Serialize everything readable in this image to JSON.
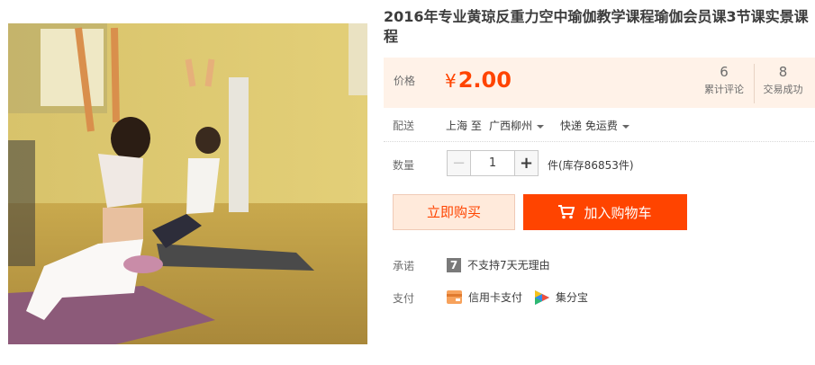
{
  "product": {
    "title": "2016年专业黄琼反重力空中瑜伽教学课程瑜伽会员课3节课实景课程",
    "image_alt": "yoga class photo"
  },
  "price": {
    "label": "价格",
    "currency": "¥",
    "value": "2.00",
    "reviews_count": "6",
    "reviews_label": "累计评论",
    "deals_count": "8",
    "deals_label": "交易成功"
  },
  "shipping": {
    "label": "配送",
    "from": "上海 至",
    "destination": "广西柳州",
    "method": "快递 免运费"
  },
  "quantity": {
    "label": "数量",
    "minus": "−",
    "plus": "+",
    "value": "1",
    "stock": "件(库存86853件)"
  },
  "actions": {
    "buy_now": "立即购买",
    "add_to_cart": "加入购物车"
  },
  "promise": {
    "label": "承诺",
    "badge": "7",
    "text": "不支持7天无理由"
  },
  "payment": {
    "label": "支付",
    "credit_card": "信用卡支付",
    "jifenbao": "集分宝"
  },
  "colors": {
    "accent": "#ff4400",
    "price_bg": "#fff2e8"
  }
}
